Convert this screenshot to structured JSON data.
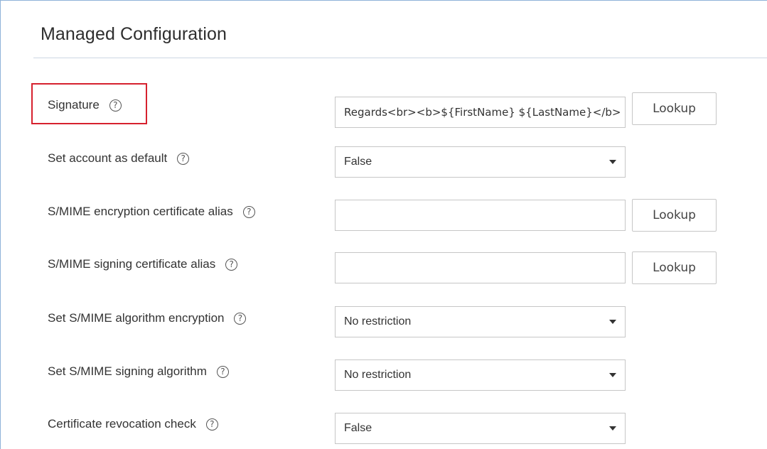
{
  "page": {
    "title": "Managed Configuration"
  },
  "help_glyph": "?",
  "rows": [
    {
      "label": "Signature",
      "control": "text",
      "value": "Regards<br><b>${FirstName} ${LastName}</b>",
      "button": "Lookup"
    },
    {
      "label": "Set account as default",
      "control": "select",
      "value": "False"
    },
    {
      "label": "S/MIME encryption certificate alias",
      "control": "text",
      "value": "",
      "button": "Lookup"
    },
    {
      "label": "S/MIME signing certificate alias",
      "control": "text",
      "value": "",
      "button": "Lookup"
    },
    {
      "label": "Set S/MIME algorithm encryption",
      "control": "select",
      "value": "No restriction"
    },
    {
      "label": "Set S/MIME signing algorithm",
      "control": "select",
      "value": "No restriction"
    },
    {
      "label": "Certificate revocation check",
      "control": "select",
      "value": "False"
    }
  ],
  "colors": {
    "highlight": "#d6212e",
    "frame_border": "#8fb3d9",
    "divider": "#cdd6e3"
  }
}
